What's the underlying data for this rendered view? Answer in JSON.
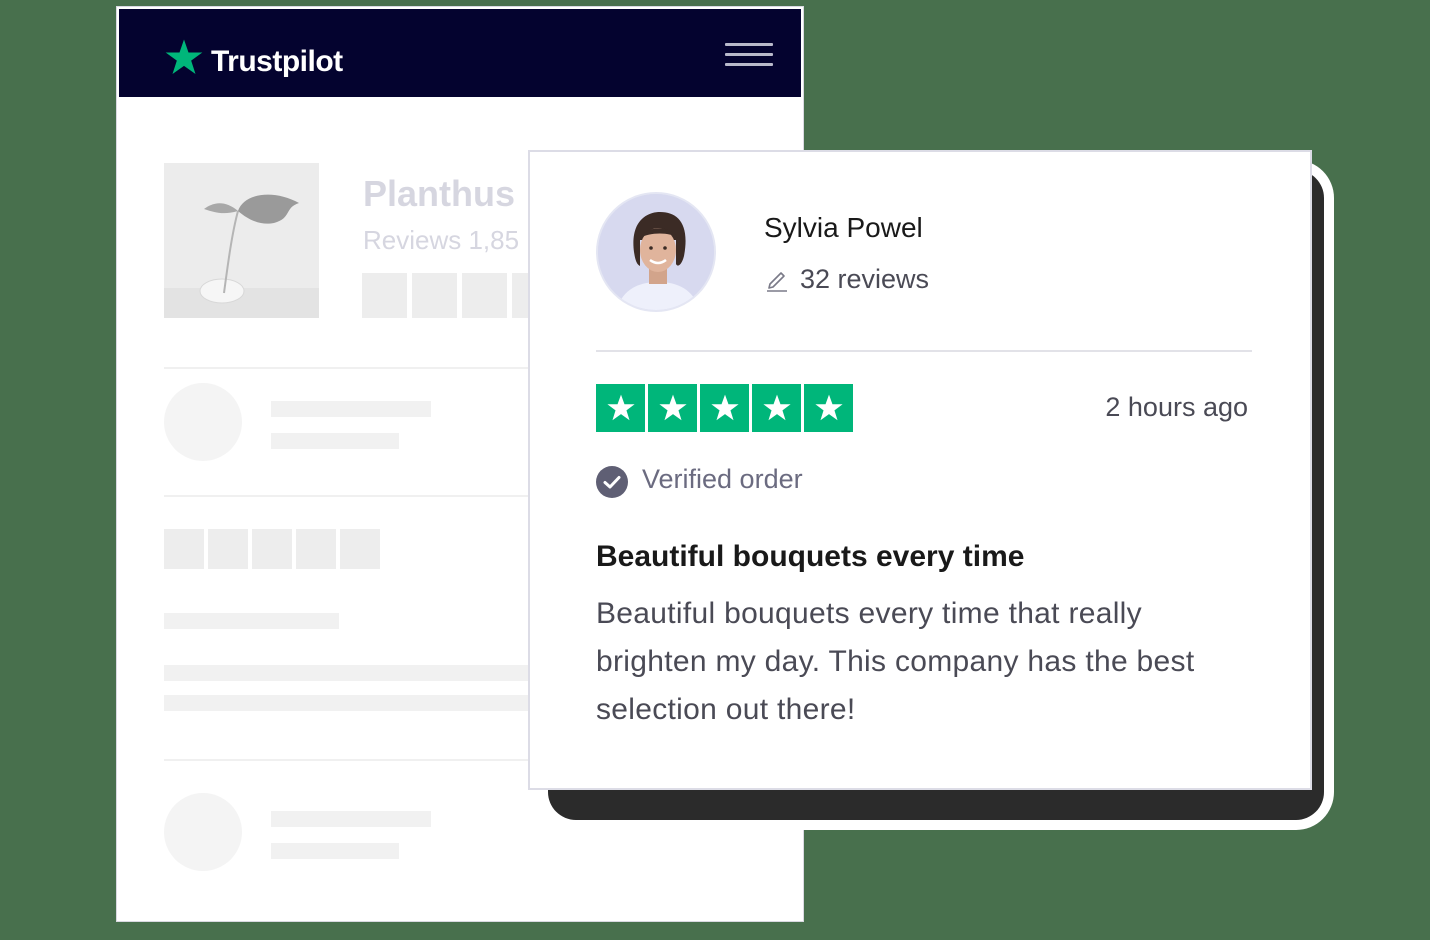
{
  "brand": {
    "name": "Trustpilot",
    "star_color": "#00b67a",
    "header_color": "#04032f"
  },
  "menu": {
    "icon": "hamburger-menu-icon"
  },
  "company": {
    "name": "Planthus",
    "reviews_text": "Reviews 1,85"
  },
  "review": {
    "reviewer_name": "Sylvia Powel",
    "review_count": "32 reviews",
    "rating": 5,
    "rating_max": 5,
    "time_ago": "2 hours ago",
    "verified_label": "Verified order",
    "title": "Beautiful bouquets every time",
    "body": "Beautiful bouquets every time that really brighten my day. This company has the best selection out there!"
  },
  "colors": {
    "background": "#48704d",
    "rating_green": "#00b67a",
    "text_dark": "#191919",
    "text_muted": "#4a4a55"
  }
}
